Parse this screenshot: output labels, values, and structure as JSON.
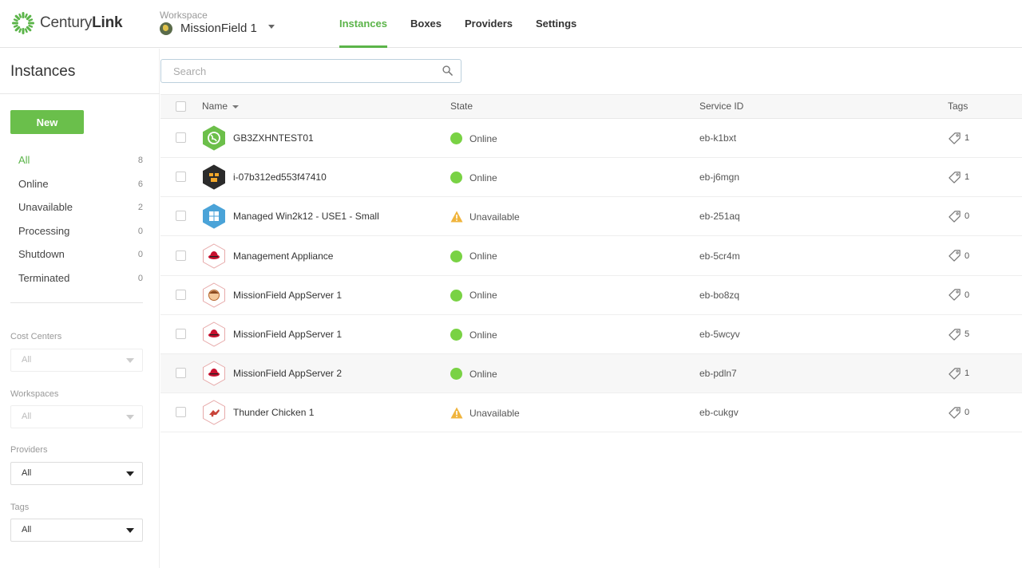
{
  "app": {
    "logo_text_light": "Century",
    "logo_text_bold": "Link",
    "brand_color": "#5bb449"
  },
  "workspace": {
    "label": "Workspace",
    "name": "MissionField 1"
  },
  "nav": {
    "items": [
      {
        "label": "Instances",
        "active": true
      },
      {
        "label": "Boxes",
        "active": false
      },
      {
        "label": "Providers",
        "active": false
      },
      {
        "label": "Settings",
        "active": false
      }
    ]
  },
  "page": {
    "title": "Instances"
  },
  "search": {
    "placeholder": "Search",
    "value": ""
  },
  "sidebar": {
    "new_button": "New",
    "filters": [
      {
        "label": "All",
        "count": "8",
        "active": true
      },
      {
        "label": "Online",
        "count": "6"
      },
      {
        "label": "Unavailable",
        "count": "2"
      },
      {
        "label": "Processing",
        "count": "0"
      },
      {
        "label": "Shutdown",
        "count": "0"
      },
      {
        "label": "Terminated",
        "count": "0"
      }
    ],
    "groups": [
      {
        "label": "Cost Centers",
        "value": "All",
        "disabled": true
      },
      {
        "label": "Workspaces",
        "value": "All",
        "disabled": true
      },
      {
        "label": "Providers",
        "value": "All",
        "disabled": false
      },
      {
        "label": "Tags",
        "value": "All",
        "disabled": false
      }
    ]
  },
  "table": {
    "headers": {
      "name": "Name",
      "state": "State",
      "service_id": "Service ID",
      "tags": "Tags"
    },
    "rows": [
      {
        "name": "GB3ZXHNTEST01",
        "state": "Online",
        "service_id": "eb-k1bxt",
        "tags": "1",
        "icon": "globe-icon"
      },
      {
        "name": "i-07b312ed553f47410",
        "state": "Online",
        "service_id": "eb-j6mgn",
        "tags": "1",
        "icon": "aws-icon"
      },
      {
        "name": "Managed Win2k12 - USE1 - Small",
        "state": "Unavailable",
        "service_id": "eb-251aq",
        "tags": "0",
        "icon": "windows-icon"
      },
      {
        "name": "Management Appliance",
        "state": "Online",
        "service_id": "eb-5cr4m",
        "tags": "0",
        "icon": "redhat-icon"
      },
      {
        "name": "MissionField AppServer 1",
        "state": "Online",
        "service_id": "eb-bo8zq",
        "tags": "0",
        "icon": "face-icon"
      },
      {
        "name": "MissionField AppServer 1",
        "state": "Online",
        "service_id": "eb-5wcyv",
        "tags": "5",
        "icon": "redhat-icon"
      },
      {
        "name": "MissionField AppServer 2",
        "state": "Online",
        "service_id": "eb-pdln7",
        "tags": "1",
        "icon": "redhat-icon"
      },
      {
        "name": "Thunder Chicken 1",
        "state": "Unavailable",
        "service_id": "eb-cukgv",
        "tags": "0",
        "icon": "chicken-icon"
      }
    ]
  }
}
